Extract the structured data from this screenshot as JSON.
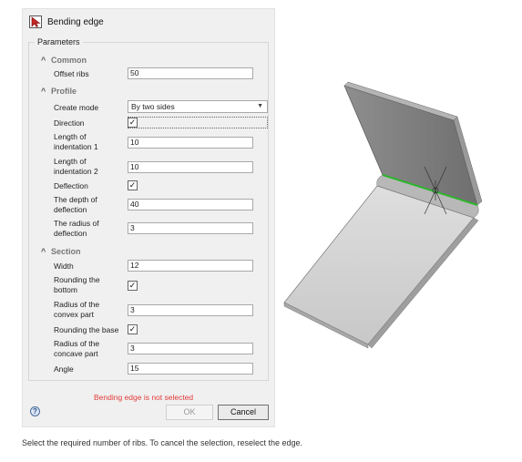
{
  "dialog": {
    "title": "Bending edge",
    "group_label": "Parameters",
    "sections": {
      "common": "Common",
      "profile": "Profile",
      "section": "Section"
    },
    "fields": {
      "offset_ribs": {
        "label": "Offset ribs",
        "value": "50"
      },
      "create_mode": {
        "label": "Create mode",
        "value": "By two sides"
      },
      "direction": {
        "label": "Direction",
        "checked": true
      },
      "length_ind1": {
        "label1": "Length of",
        "label2": "indentation 1",
        "value": "10"
      },
      "length_ind2": {
        "label1": "Length of",
        "label2": "indentation 2",
        "value": "10"
      },
      "deflection": {
        "label": "Deflection",
        "checked": true
      },
      "depth_deflection": {
        "label1": "The depth of",
        "label2": "deflection",
        "value": "40"
      },
      "radius_deflection": {
        "label1": "The radius of",
        "label2": "deflection",
        "value": "3"
      },
      "width": {
        "label": "Width",
        "value": "12"
      },
      "rounding_bottom": {
        "label1": "Rounding the",
        "label2": "bottom",
        "checked": true
      },
      "radius_convex": {
        "label1": "Radius of the",
        "label2": "convex part",
        "value": "3"
      },
      "rounding_base": {
        "label": "Rounding the base",
        "checked": true
      },
      "radius_concave": {
        "label1": "Radius of the",
        "label2": "concave part",
        "value": "3"
      },
      "angle": {
        "label": "Angle",
        "value": "15"
      }
    },
    "error": "Bending edge is not selected",
    "help_label": "?",
    "ok_label": "OK",
    "cancel_label": "Cancel"
  },
  "caption": "Select the required number of ribs. To cancel the selection, reselect the edge.",
  "check_mark": "✓",
  "chevron_up": "^",
  "colors": {
    "panel_bg": "#f0f0f0",
    "error": "#e23b3b",
    "edge_highlight": "#2db52d",
    "model_light": "#d4d4d4",
    "model_dark": "#7a7a7a"
  }
}
